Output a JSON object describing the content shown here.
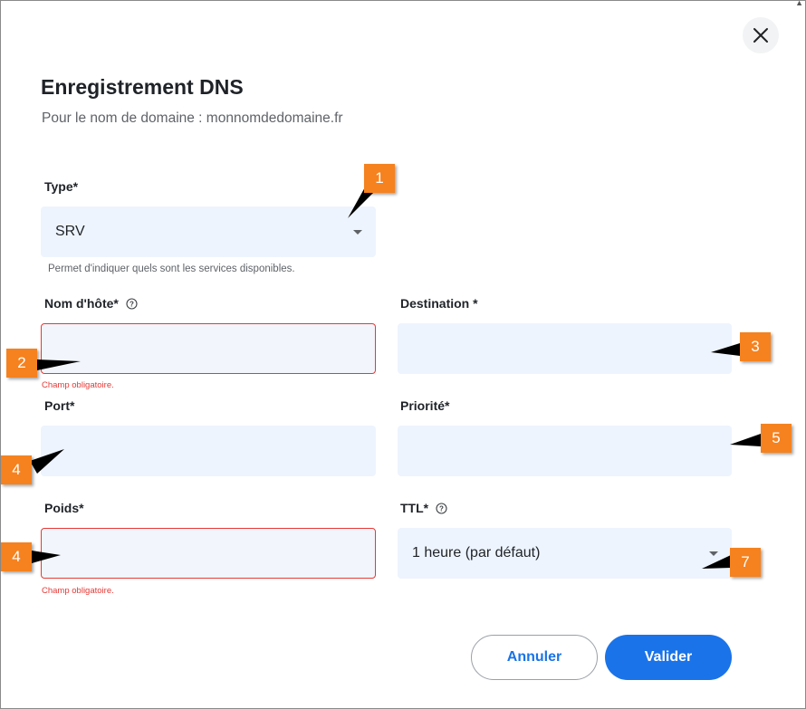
{
  "dialog": {
    "corner_mark": "▲",
    "title": "Enregistrement DNS",
    "subtitle": "Pour le nom de domaine : monnomdedomaine.fr",
    "close_icon": "close-icon"
  },
  "form": {
    "type": {
      "label": "Type*",
      "value": "SRV",
      "helper": "Permet d'indiquer quels sont les services disponibles."
    },
    "hostname": {
      "label": "Nom d'hôte*",
      "value": "",
      "error": "Champ obligatoire."
    },
    "destination": {
      "label": "Destination *",
      "value": ""
    },
    "port": {
      "label": "Port*",
      "value": ""
    },
    "priority": {
      "label": "Priorité*",
      "value": ""
    },
    "weight": {
      "label": "Poids*",
      "value": "",
      "error": "Champ obligatoire."
    },
    "ttl": {
      "label": "TTL*",
      "value": "1 heure (par défaut)"
    }
  },
  "actions": {
    "cancel_label": "Annuler",
    "submit_label": "Valider"
  },
  "annotations": [
    {
      "id": "badge-1",
      "text": "1"
    },
    {
      "id": "badge-2",
      "text": "2"
    },
    {
      "id": "badge-3",
      "text": "3"
    },
    {
      "id": "badge-4a",
      "text": "4"
    },
    {
      "id": "badge-5",
      "text": "5"
    },
    {
      "id": "badge-4b",
      "text": "4"
    },
    {
      "id": "badge-7",
      "text": "7"
    }
  ],
  "colors": {
    "accent": "#1a73e8",
    "error": "#e53935",
    "field_bg": "#eef4fd",
    "badge": "#f5821f"
  }
}
